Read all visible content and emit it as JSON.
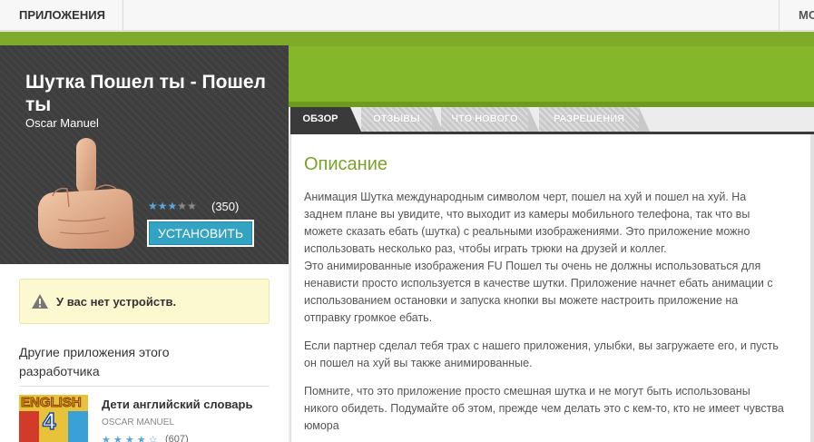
{
  "topnav": {
    "apps_label": "ПРИЛОЖЕНИЯ",
    "right_label": "МО"
  },
  "app": {
    "title": "Шутка Пошел ты - Пошел ты",
    "developer": "Oscar Manuel",
    "rating": 3.5,
    "rating_max": 5,
    "rating_count": "(350)",
    "install_label": "УСТАНОВИТЬ"
  },
  "sidebar": {
    "warning_text": "У вас нет устройств.",
    "other_title": "Другие приложения этого разработчика",
    "related": [
      {
        "name": "Дети английский словарь",
        "developer": "OSCAR MANUEL",
        "thumb_text": "ENGLISH",
        "thumb_number": "4",
        "rating": 4,
        "rating_count": "(607)"
      }
    ]
  },
  "tabs": [
    {
      "label": "ОБЗОР",
      "active": true
    },
    {
      "label": "ОТЗЫВЫ",
      "active": false
    },
    {
      "label": "ЧТО НОВОГО",
      "active": false
    },
    {
      "label": "РАЗРЕШЕНИЯ",
      "active": false
    }
  ],
  "description": {
    "title": "Описание",
    "paragraphs": [
      "Анимация Шутка международным символом черт, пошел на хуй и пошел на хуй. На заднем плане вы увидите, что выходит из камеры мобильного телефона, так что вы можете сказать ебать (шутка) с реальными изображениями. Это приложение можно использовать несколько раз, чтобы играть трюки на друзей и коллег.",
      "Это анимированные изображения FU Пошел ты очень не должны использоваться для ненависти просто используется в качестве шутки. Приложение начнет ебать анимации с использованием остановки и запуска кнопки вы можете настроить приложение на отправку громкое ебать.",
      "Если партнер сделал тебя трах с нашего приложения, улыбки, вы загружаете его, и пусть он пошел на хуй вы также анимированные.",
      "Помните, что это приложение просто смешная шутка и не могут быть использованы никого обидеть. Подумайте об этом, прежде чем делать это с кем-то, кто не имеет чувства юмора"
    ]
  },
  "colors": {
    "brand_green": "#84b82a",
    "title_green": "#7aa32a",
    "install_blue": "#33a3c4",
    "star_blue": "#5aa6d8"
  }
}
